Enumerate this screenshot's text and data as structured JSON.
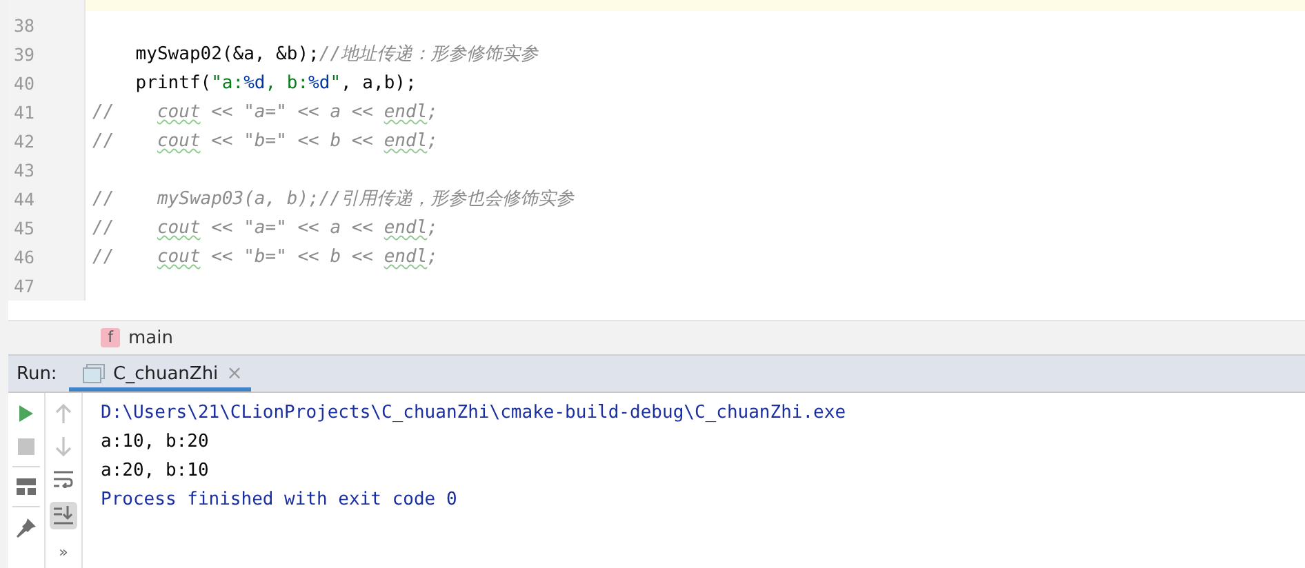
{
  "editor": {
    "lines": [
      {
        "current": true
      },
      {
        "number": "38",
        "current": false
      },
      {
        "number": "39",
        "current": false,
        "segments": [
          {
            "kind": "code",
            "text": "    mySwap02(&a, &b);"
          },
          {
            "kind": "comment",
            "text": "//地址传递：形参修饰实参"
          }
        ]
      },
      {
        "number": "40",
        "current": false,
        "segments": [
          {
            "kind": "code",
            "text": "    printf("
          },
          {
            "kind": "string",
            "text": "\"a:"
          },
          {
            "kind": "escape",
            "text": "%d"
          },
          {
            "kind": "string",
            "text": ", b:"
          },
          {
            "kind": "escape",
            "text": "%d"
          },
          {
            "kind": "string",
            "text": "\""
          },
          {
            "kind": "code",
            "text": ", a,b);"
          }
        ]
      },
      {
        "number": "41",
        "current": false,
        "segments": [
          {
            "kind": "comment",
            "text": "//    "
          },
          {
            "kind": "typo",
            "text": "cout"
          },
          {
            "kind": "comment",
            "text": " << \"a=\" << a << "
          },
          {
            "kind": "typo",
            "text": "endl"
          },
          {
            "kind": "comment",
            "text": ";"
          }
        ]
      },
      {
        "number": "42",
        "current": false,
        "segments": [
          {
            "kind": "comment",
            "text": "//    "
          },
          {
            "kind": "typo",
            "text": "cout"
          },
          {
            "kind": "comment",
            "text": " << \"b=\" << b << "
          },
          {
            "kind": "typo",
            "text": "endl"
          },
          {
            "kind": "comment",
            "text": ";"
          }
        ]
      },
      {
        "number": "43",
        "current": false
      },
      {
        "number": "44",
        "current": false,
        "segments": [
          {
            "kind": "comment",
            "text": "//    mySwap03(a, b);//引用传递，形参也会修饰实参"
          }
        ]
      },
      {
        "number": "45",
        "current": false,
        "segments": [
          {
            "kind": "comment",
            "text": "//    "
          },
          {
            "kind": "typo",
            "text": "cout"
          },
          {
            "kind": "comment",
            "text": " << \"a=\" << a << "
          },
          {
            "kind": "typo",
            "text": "endl"
          },
          {
            "kind": "comment",
            "text": ";"
          }
        ]
      },
      {
        "number": "46",
        "current": false,
        "segments": [
          {
            "kind": "comment",
            "text": "//    "
          },
          {
            "kind": "typo",
            "text": "cout"
          },
          {
            "kind": "comment",
            "text": " << \"b=\" << b << "
          },
          {
            "kind": "typo",
            "text": "endl"
          },
          {
            "kind": "comment",
            "text": ";"
          }
        ]
      },
      {
        "number": "47",
        "current": false
      }
    ]
  },
  "breadcrumb": {
    "badge": "f",
    "label": "main"
  },
  "run_panel": {
    "label": "Run:",
    "tabs": [
      {
        "label": "C_chuanZhi",
        "selected": true,
        "close": "×"
      }
    ],
    "toolbar_more": "»",
    "output": [
      {
        "kind": "system",
        "text": "D:\\Users\\21\\CLionProjects\\C_chuanZhi\\cmake-build-debug\\C_chuanZhi.exe"
      },
      {
        "kind": "stdout",
        "text": "a:10, b:20"
      },
      {
        "kind": "stdout",
        "text": "a:20, b:10"
      },
      {
        "kind": "system",
        "text": "Process finished with exit code 0"
      }
    ]
  }
}
